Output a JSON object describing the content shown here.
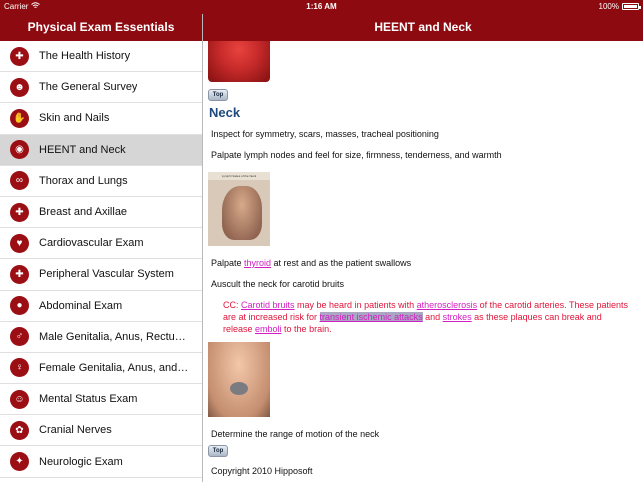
{
  "status": {
    "carrier": "Carrier",
    "time": "1:16 AM",
    "battery": "100%"
  },
  "nav": {
    "left_title": "Physical Exam Essentials",
    "right_title": "HEENT and Neck"
  },
  "sidebar": {
    "items": [
      {
        "label": "The Health History",
        "icon": "history-icon"
      },
      {
        "label": "The General Survey",
        "icon": "person-icon"
      },
      {
        "label": "Skin and Nails",
        "icon": "hand-icon"
      },
      {
        "label": "HEENT and Neck",
        "icon": "eye-icon",
        "selected": true
      },
      {
        "label": "Thorax and Lungs",
        "icon": "stethoscope-icon"
      },
      {
        "label": "Breast and Axillae",
        "icon": "breast-icon"
      },
      {
        "label": "Cardiovascular Exam",
        "icon": "heart-icon"
      },
      {
        "label": "Peripheral Vascular System",
        "icon": "vessel-icon"
      },
      {
        "label": "Abdominal Exam",
        "icon": "abdomen-icon"
      },
      {
        "label": "Male Genitalia, Anus, Rectu…",
        "icon": "male-icon"
      },
      {
        "label": "Female Genitalia, Anus, and…",
        "icon": "female-icon"
      },
      {
        "label": "Mental Status Exam",
        "icon": "head-icon"
      },
      {
        "label": "Cranial Nerves",
        "icon": "brain-icon"
      },
      {
        "label": "Neurologic Exam",
        "icon": "neuro-icon"
      }
    ]
  },
  "content": {
    "top_label": "Top",
    "section_title": "Neck",
    "line1": "Inspect for symmetry, scars, masses, tracheal positioning",
    "line2": "Palpate lymph nodes and feel for size, firmness, tenderness, and warmth",
    "lymph_image_caption": "Lymph Nodes of the Neck",
    "palpate_prefix": "Palpate ",
    "palpate_link": "thyroid",
    "palpate_suffix": " at rest and as the patient swallows",
    "auscult": "Auscult the neck for carotid bruits",
    "cc_prefix": "CC: ",
    "cc_link1": "Carotid bruits",
    "cc_text1": " may be heard in patients with ",
    "cc_link2": "atherosclerosis",
    "cc_text2": " of the carotid arteries.  These patients are at increased risk for ",
    "cc_link3": "transient ischemic attacks",
    "cc_text3": " and ",
    "cc_link4": "strokes",
    "cc_text4": " as these plaques can break and release ",
    "cc_link5": "emboli",
    "cc_text5": " to the brain.",
    "rom": "Determine the range of motion of the neck",
    "copyright": "Copyright 2010 Hipposoft"
  },
  "colors": {
    "brand": "#8d0b10",
    "heading": "#1f4a7c",
    "cc_text": "#e0153a",
    "link": "#d31ec4"
  }
}
